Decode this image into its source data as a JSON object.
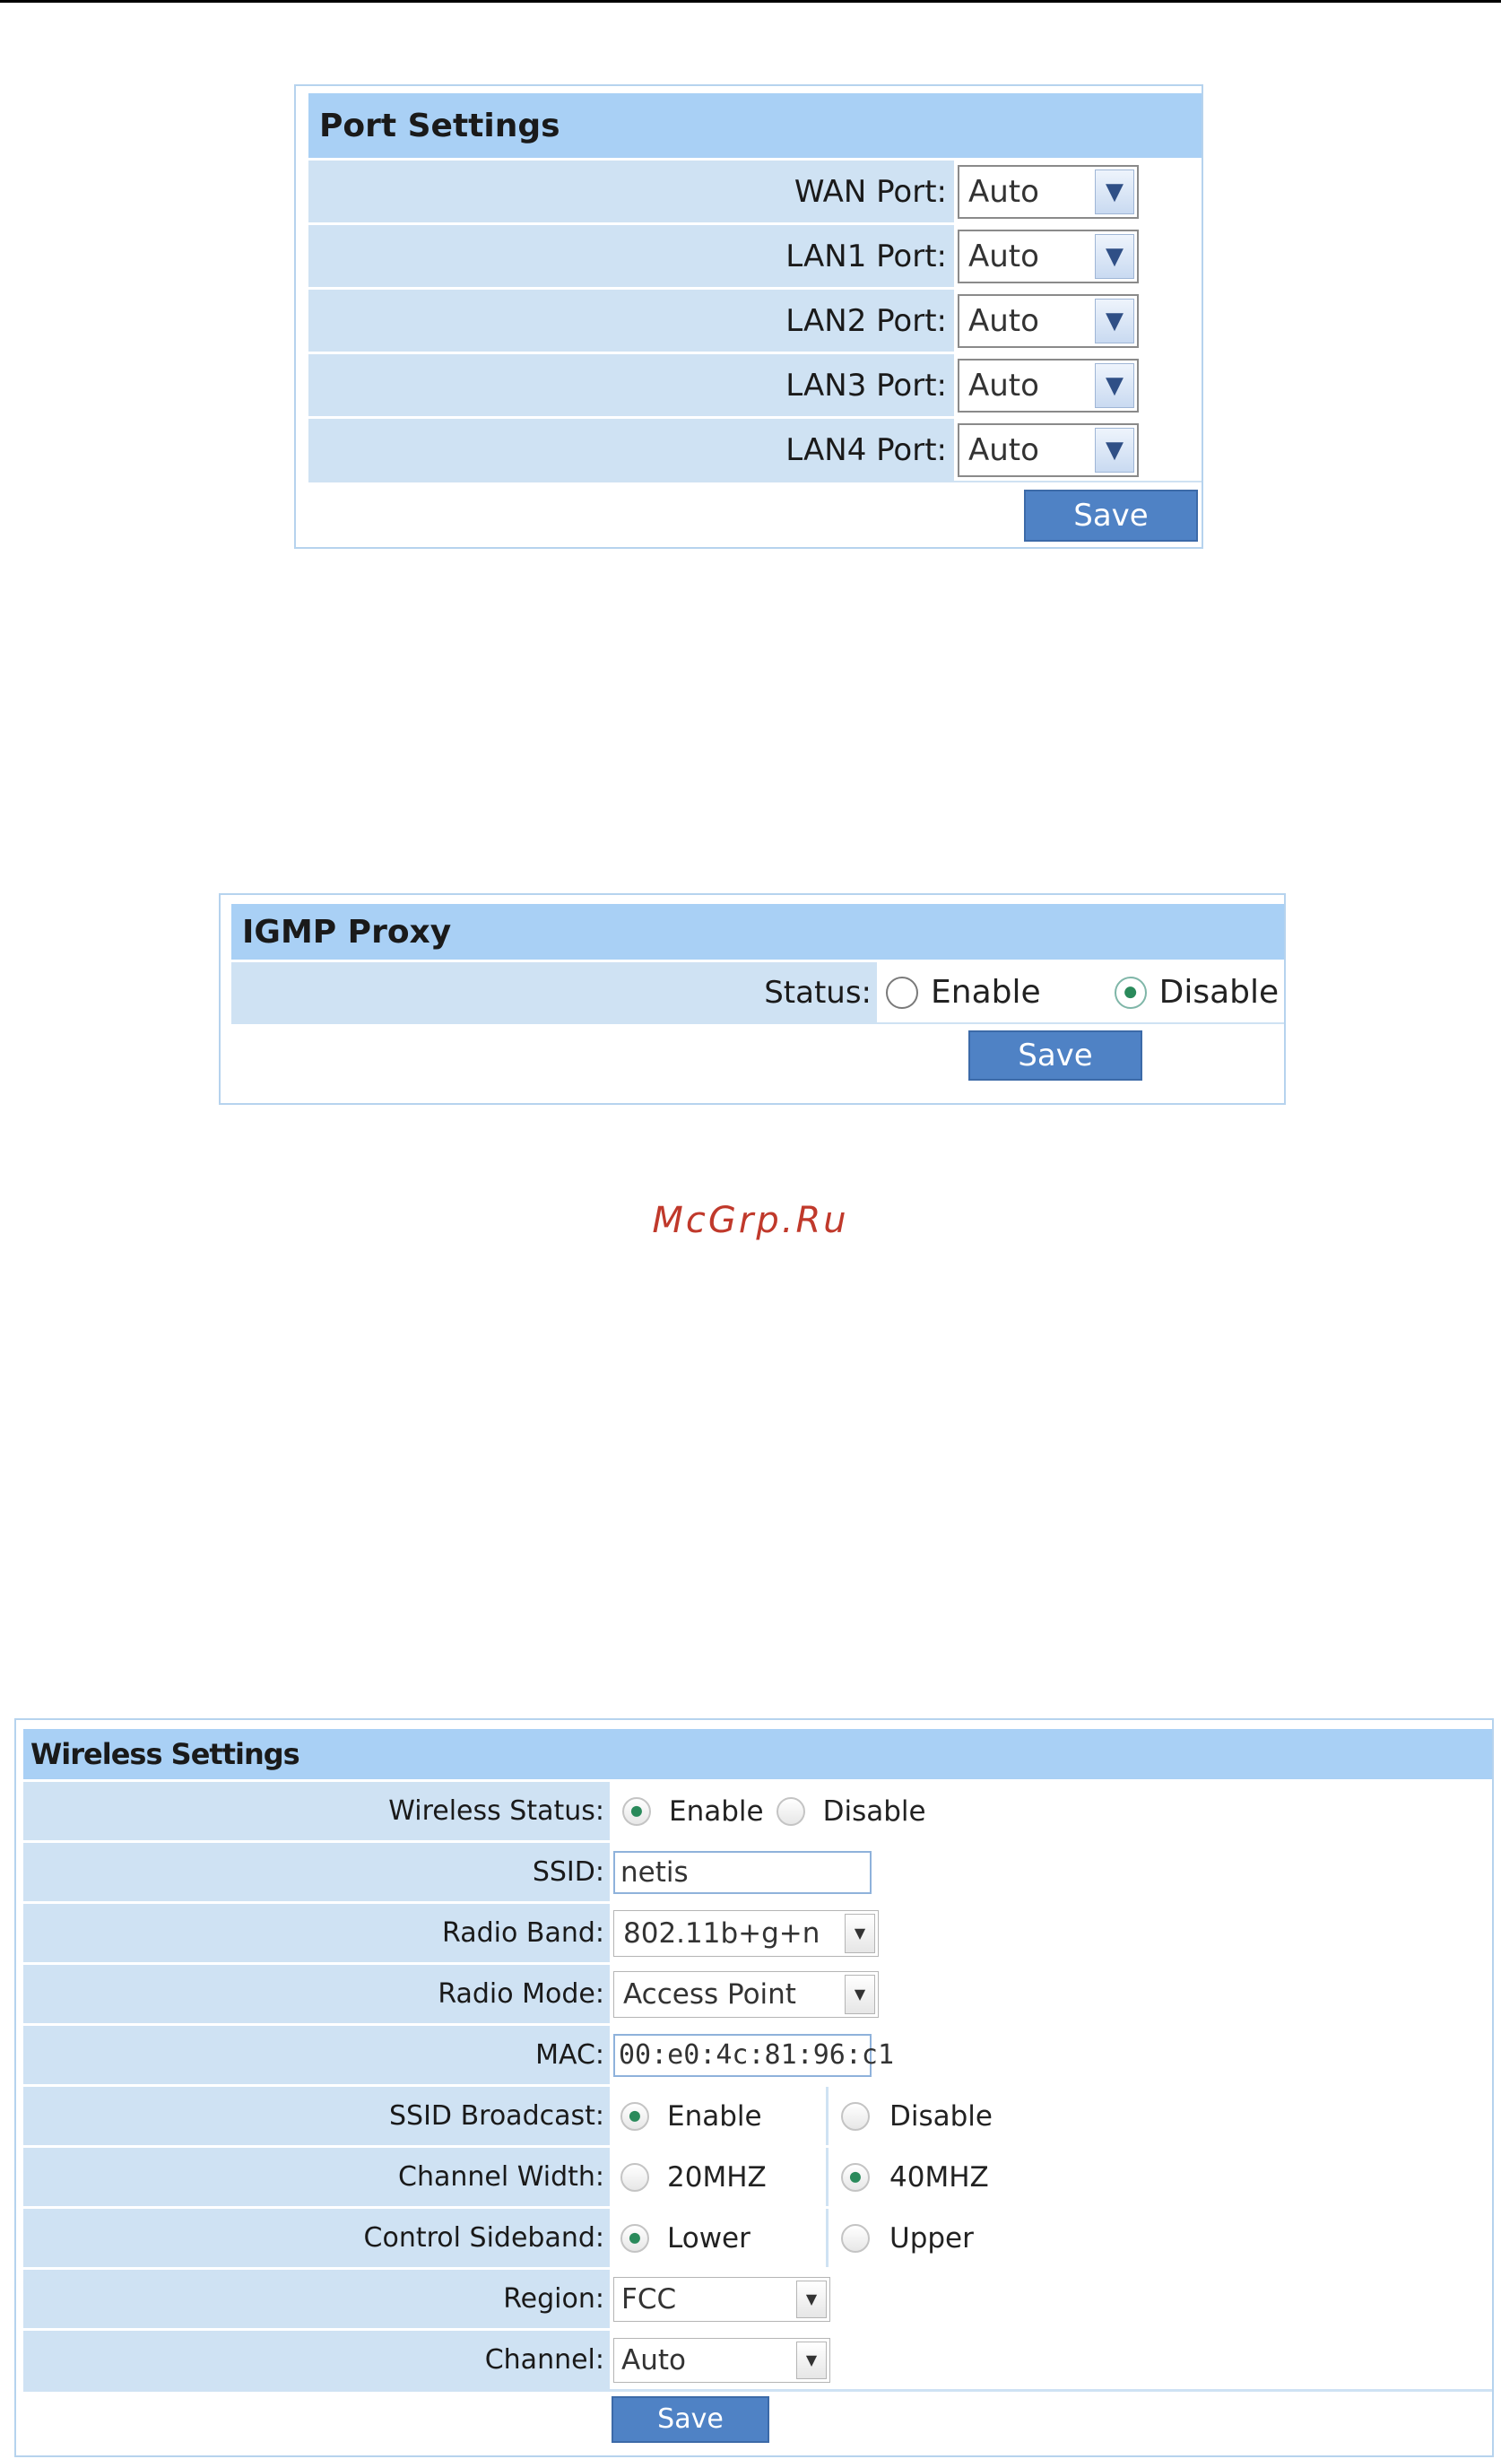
{
  "port_settings": {
    "title": "Port Settings",
    "rows": [
      {
        "label": "WAN Port:",
        "value": "Auto"
      },
      {
        "label": "LAN1 Port:",
        "value": "Auto"
      },
      {
        "label": "LAN2 Port:",
        "value": "Auto"
      },
      {
        "label": "LAN3 Port:",
        "value": "Auto"
      },
      {
        "label": "LAN4 Port:",
        "value": "Auto"
      }
    ],
    "save_label": "Save"
  },
  "igmp_proxy": {
    "title": "IGMP Proxy",
    "status_label": "Status:",
    "options": [
      "Enable",
      "Disable"
    ],
    "selected": "Disable",
    "save_label": "Save"
  },
  "watermark": "McGrp.Ru",
  "wireless_settings": {
    "title": "Wireless Settings",
    "wireless_status": {
      "label": "Wireless Status:",
      "options": [
        "Enable",
        "Disable"
      ],
      "selected": "Enable"
    },
    "ssid": {
      "label": "SSID:",
      "value": "netis"
    },
    "radio_band": {
      "label": "Radio Band:",
      "value": "802.11b+g+n"
    },
    "radio_mode": {
      "label": "Radio Mode:",
      "value": "Access Point"
    },
    "mac": {
      "label": "MAC:",
      "value": "00:e0:4c:81:96:c1"
    },
    "ssid_broadcast": {
      "label": "SSID Broadcast:",
      "options": [
        "Enable",
        "Disable"
      ],
      "selected": "Enable"
    },
    "channel_width": {
      "label": "Channel Width:",
      "options": [
        "20MHZ",
        "40MHZ"
      ],
      "selected": "40MHZ"
    },
    "control_sideband": {
      "label": "Control Sideband:",
      "options": [
        "Lower",
        "Upper"
      ],
      "selected": "Lower"
    },
    "region": {
      "label": "Region:",
      "value": "FCC"
    },
    "channel": {
      "label": "Channel:",
      "value": "Auto"
    },
    "save_label": "Save"
  },
  "colors": {
    "header": "#a9d0f5",
    "label_bg": "#cfe2f3",
    "button": "#4f82c5",
    "watermark": "#c0392b"
  },
  "icons": [
    "chevron-down-icon",
    "radio-icon"
  ]
}
